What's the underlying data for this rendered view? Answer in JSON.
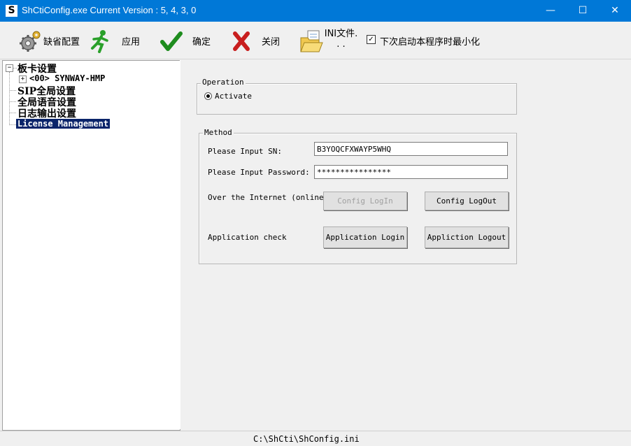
{
  "window": {
    "title": "ShCtiConfig.exe   Current Version : 5, 4, 3, 0",
    "app_icon": "S",
    "minimize_glyph": "—",
    "maximize_glyph": "☐",
    "close_glyph": "✕"
  },
  "toolbar": {
    "default_config_label": "缺省配置",
    "apply_label": "应用",
    "ok_label": "确定",
    "close_label": "关闭",
    "ini_file_label": "INI文件. . .",
    "minimize_on_start_label": "下次启动本程序时最小化",
    "minimize_on_start_checked": true,
    "check_glyph": "✓",
    "icons": [
      "gears-icon",
      "running-man-icon",
      "green-check-icon",
      "red-x-icon",
      "folder-document-icon"
    ]
  },
  "tree": {
    "root_label": "板卡设置",
    "root_expander": "⊟",
    "board_label": "<00> SYNWAY-HMP",
    "board_expander": "+",
    "sip_label": "SIP全局设置",
    "voice_label": "全局语音设置",
    "log_label": "日志输出设置",
    "license_label": "License Management"
  },
  "operation": {
    "legend": "Operation",
    "activate_label": "Activate"
  },
  "method": {
    "legend": "Method",
    "sn_label": "Please Input SN:",
    "sn_value": "B3YOQCFXWAYP5WHQ",
    "password_label": "Please Input Password:",
    "password_value": "****************",
    "internet_label": "Over the Internet (online)",
    "config_login_label": "Config LogIn",
    "config_logout_label": "Config LogOut",
    "app_check_label": "Application check",
    "app_login_label": "Application Login",
    "app_logout_label": "Appliction Logout"
  },
  "status": {
    "ini_path": "C:\\ShCti\\ShConfig.ini"
  },
  "colors": {
    "titlebar": "#0078d7",
    "selection": "#0a246a"
  }
}
